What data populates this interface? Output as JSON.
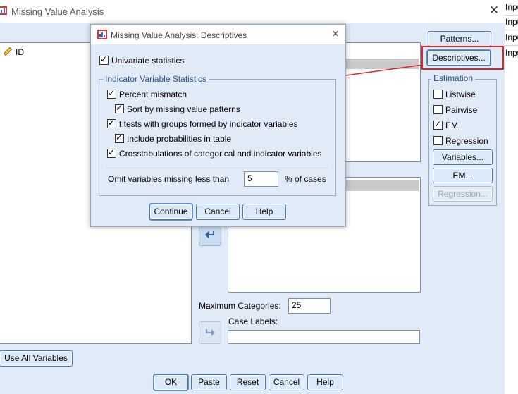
{
  "main_window": {
    "title": "Missing Value Analysis",
    "variable_list": [
      "ID"
    ],
    "buttons": {
      "patterns": "Patterns...",
      "descriptives": "Descriptives...",
      "use_all": "Use All Variables",
      "ok": "OK",
      "paste": "Paste",
      "reset": "Reset",
      "cancel": "Cancel",
      "help": "Help"
    },
    "estimation": {
      "legend": "Estimation",
      "listwise": {
        "label": "Listwise",
        "checked": false
      },
      "pairwise": {
        "label": "Pairwise",
        "checked": false
      },
      "em": {
        "label": "EM",
        "checked": true
      },
      "regression": {
        "label": "Regression",
        "checked": false
      },
      "variables_btn": "Variables...",
      "em_btn": "EM...",
      "regression_btn": "Regression..."
    },
    "max_categories_label": "Maximum Categories:",
    "max_categories_value": "25",
    "case_labels_label": "Case Labels:",
    "case_labels_value": ""
  },
  "sheet_cells": [
    "Inpu",
    "Inpu",
    "Inpu",
    "Inpu"
  ],
  "dialog": {
    "title": "Missing Value Analysis: Descriptives",
    "univariate": {
      "label": "Univariate statistics",
      "checked": true
    },
    "group_legend": "Indicator Variable Statistics",
    "percent_mismatch": {
      "label": "Percent mismatch",
      "checked": true
    },
    "sort_by_patterns": {
      "label": "Sort by missing value patterns",
      "checked": true
    },
    "t_tests": {
      "label": "t tests with groups formed by indicator variables",
      "checked": true
    },
    "include_probabilities": {
      "label": "Include probabilities in table",
      "checked": true
    },
    "crosstabs": {
      "label": "Crosstabulations of categorical and indicator variables",
      "checked": true
    },
    "omit_label": "Omit variables missing less than",
    "omit_value": "5",
    "omit_suffix": "% of cases",
    "buttons": {
      "continue": "Continue",
      "cancel": "Cancel",
      "help": "Help"
    }
  },
  "annotation_color": "#e0242c"
}
